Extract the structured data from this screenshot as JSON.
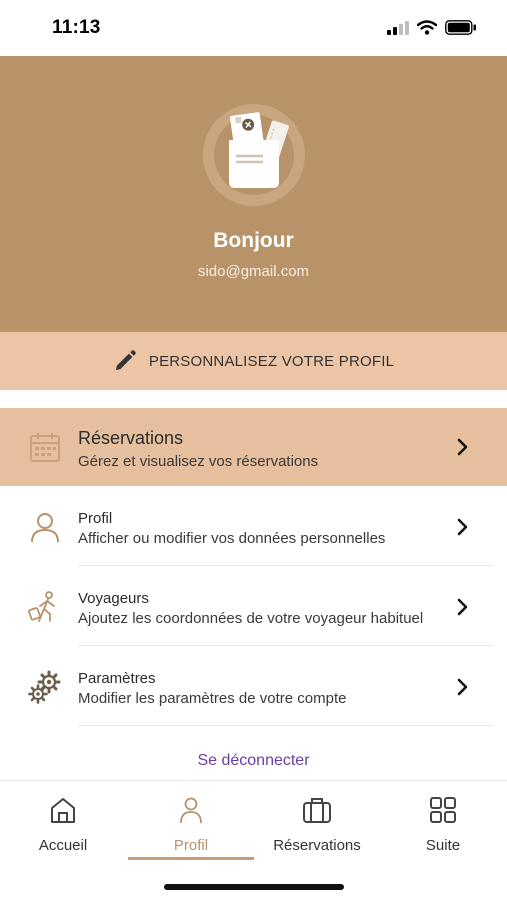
{
  "status_bar": {
    "time": "11:13",
    "icons": [
      "signal-icon",
      "wifi-icon",
      "battery-icon"
    ]
  },
  "header": {
    "greeting": "Bonjour",
    "email": "sido@gmail.com",
    "avatar_icon": "travel-wallet-icon",
    "background_color": "#b8936a"
  },
  "customize": {
    "icon": "pencil-icon",
    "label": "PERSONNALISEZ VOTRE PROFIL"
  },
  "menu": [
    {
      "icon": "calendar-icon",
      "title": "Réservations",
      "subtitle": "Gérez et visualisez vos réservations",
      "highlighted": true
    },
    {
      "icon": "person-icon",
      "title": "Profil",
      "subtitle": "Afficher ou modifier vos données personnelles",
      "highlighted": false
    },
    {
      "icon": "traveler-icon",
      "title": "Voyageurs",
      "subtitle": "Ajoutez les coordonnées de votre voyageur habituel",
      "highlighted": false
    },
    {
      "icon": "gears-icon",
      "title": "Paramètres",
      "subtitle": "Modifier les paramètres de votre compte",
      "highlighted": false
    }
  ],
  "logout_label": "Se déconnecter",
  "bottom_nav": [
    {
      "icon": "home-icon",
      "label": "Accueil",
      "active": false
    },
    {
      "icon": "person-icon",
      "label": "Profil",
      "active": true
    },
    {
      "icon": "suitcase-icon",
      "label": "Réservations",
      "active": false
    },
    {
      "icon": "grid-icon",
      "label": "Suite",
      "active": false
    }
  ],
  "colors": {
    "accent": "#b8936a",
    "highlight": "#e5bf9e",
    "customize_bar": "#ebc5a6",
    "logout": "#6a3fa1"
  }
}
